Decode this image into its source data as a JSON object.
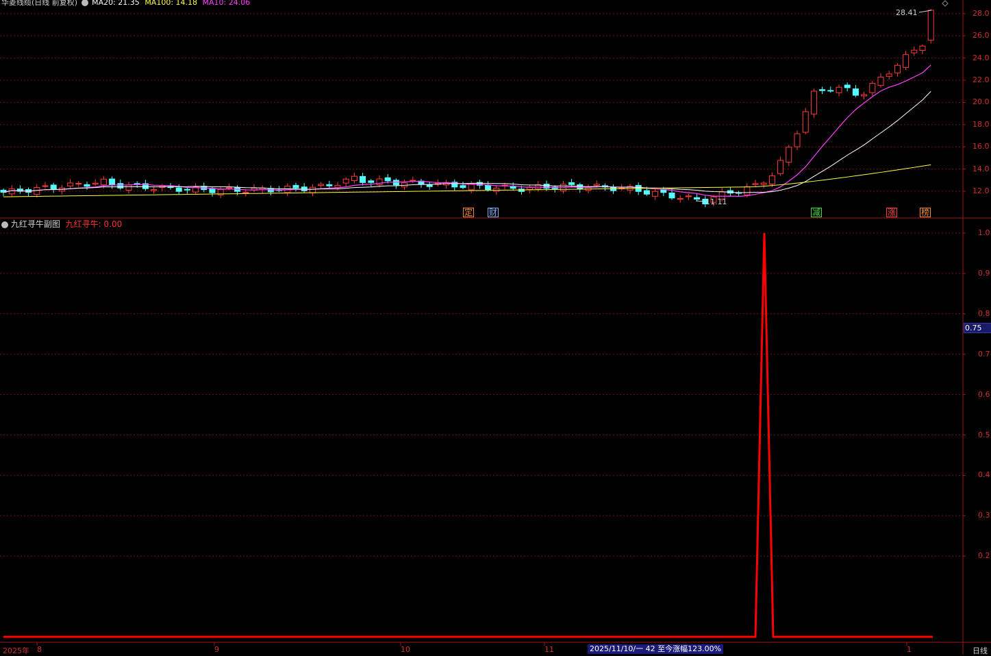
{
  "main_header": {
    "title": "华菱线缆(日线 前复权)",
    "ma20": "MA20: 21.35",
    "ma100": "MA100: 14.18",
    "ma10": "MA10: 24.06"
  },
  "sub_header": {
    "title": "九红寻牛副图",
    "value": "九红寻牛: 0.00"
  },
  "price_axis": {
    "ticks": [
      "28.0",
      "26.0",
      "24.0",
      "22.0",
      "20.0",
      "18.0",
      "16.0",
      "14.0",
      "12.0"
    ],
    "high_label": "28.41",
    "low_label": "11.11"
  },
  "indicator_axis": {
    "ticks": [
      "1.0",
      "0.9",
      "0.8",
      "0.7",
      "0.6",
      "0.5",
      "0.4",
      "0.3",
      "0.2"
    ],
    "current": "0.75"
  },
  "markers": [
    {
      "text": "定",
      "color": "#ff8c2a"
    },
    {
      "text": "财",
      "color": "#7fb0ff"
    },
    {
      "text": "减",
      "color": "#40e040"
    },
    {
      "text": "涨",
      "color": "#ff4040"
    },
    {
      "text": "榜",
      "color": "#ff8c2a"
    }
  ],
  "time_axis": {
    "labels": [
      "2025年",
      "8",
      "9",
      "10",
      "11",
      "1"
    ],
    "info": "2025/11/10/一 42 至今涨幅123.00%",
    "period": "日线"
  },
  "colors": {
    "up": "#ff3c3c",
    "down": "#54ffff",
    "ma10": "#ff40ff",
    "ma20": "#ffffff",
    "ma100": "#ffff40",
    "grid": "#7a1010",
    "indicator": "#ff0000"
  },
  "chart_data": {
    "type": "candlestick",
    "y_range": [
      11,
      28.5
    ],
    "indicator": {
      "name": "九红寻牛",
      "y_range": [
        0,
        1
      ],
      "peak_value": 1.0,
      "baseline": 0.0
    }
  }
}
